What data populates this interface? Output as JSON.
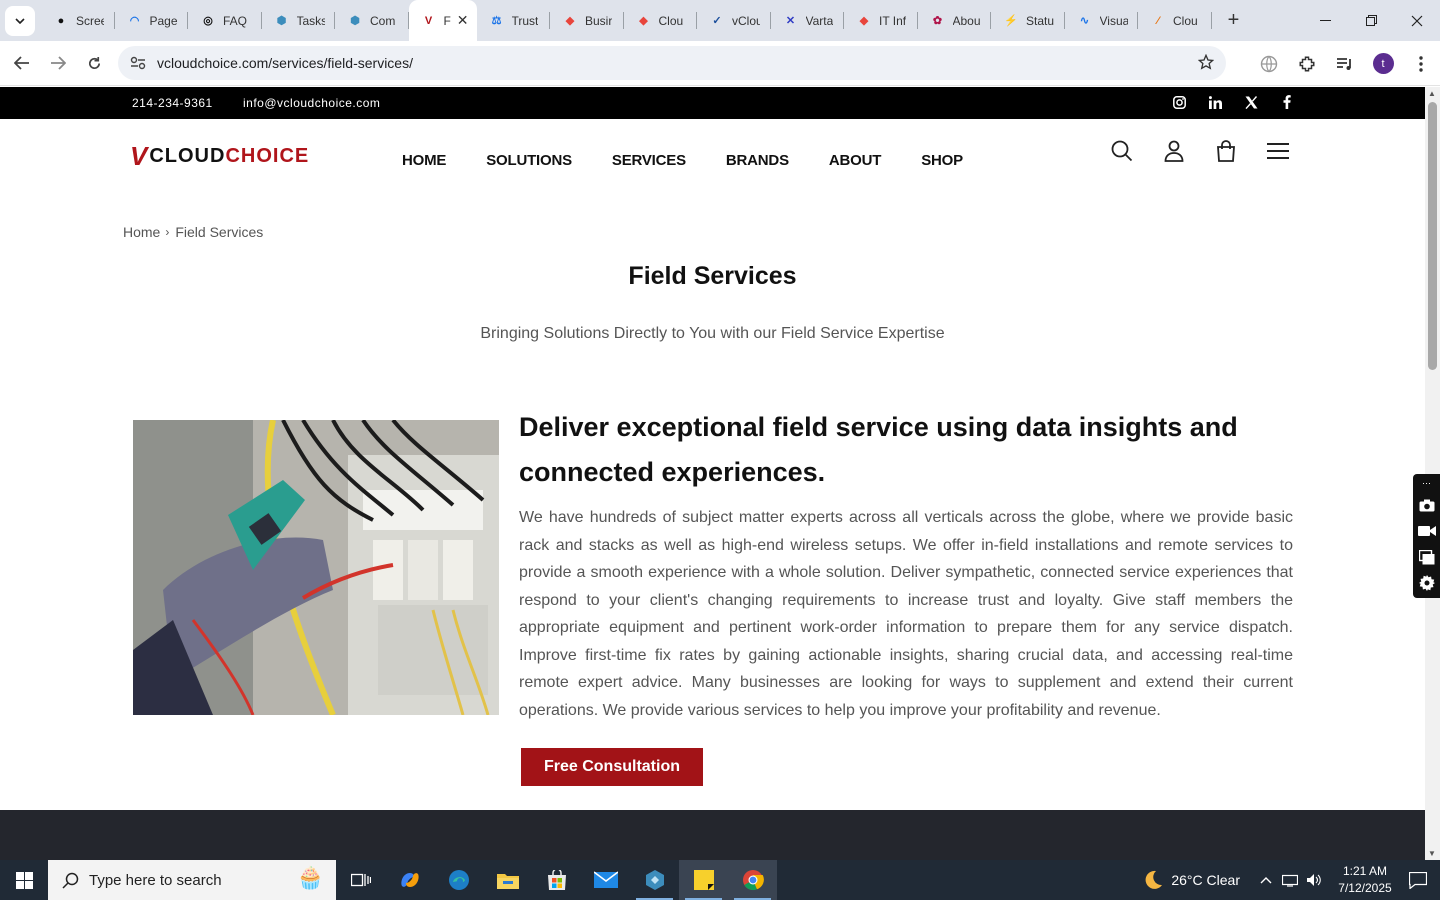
{
  "browser": {
    "tabs": [
      {
        "title": "Scree",
        "icon": "github-icon"
      },
      {
        "title": "Page",
        "icon": "gauge-icon"
      },
      {
        "title": "FAQ",
        "icon": "openai-icon"
      },
      {
        "title": "Tasks",
        "icon": "hexagon-icon"
      },
      {
        "title": "Com",
        "icon": "hexagon-icon"
      },
      {
        "title": "F",
        "icon": "vcloud-icon",
        "active": true
      },
      {
        "title": "Trust",
        "icon": "scales-icon"
      },
      {
        "title": "Busir",
        "icon": "tag-icon"
      },
      {
        "title": "Clou",
        "icon": "tag-icon"
      },
      {
        "title": "vClou",
        "icon": "check-icon"
      },
      {
        "title": "Varta",
        "icon": "x-brand-icon"
      },
      {
        "title": "IT Inf",
        "icon": "tag-icon"
      },
      {
        "title": "Abou",
        "icon": "flower-icon"
      },
      {
        "title": "Statu",
        "icon": "spark-icon"
      },
      {
        "title": "Visua",
        "icon": "pulse-icon"
      },
      {
        "title": "Clou",
        "icon": "slash-icon"
      }
    ],
    "url": "vcloudchoice.com/services/field-services/"
  },
  "site": {
    "phone": "214-234-9361",
    "email": "info@vcloudchoice.com",
    "logo": {
      "mark": "V",
      "part1": "CLOUD",
      "part2": "CHOICE"
    },
    "nav": [
      "HOME",
      "SOLUTIONS",
      "SERVICES",
      "BRANDS",
      "ABOUT",
      "SHOP"
    ],
    "breadcrumb": {
      "home": "Home",
      "current": "Field Services"
    },
    "page_title": "Field Services",
    "subtitle": "Bringing Solutions Directly to You with our Field Service Expertise",
    "heading": "Deliver exceptional field service using data insights and connected experiences.",
    "body": "We have hundreds of subject matter experts across all verticals across the globe, where we provide basic rack and stacks as well as high-end wireless setups. We offer in-field installations and remote services to provide a smooth experience with a whole solution. Deliver sympathetic, connected service experiences that respond to your client's changing requirements to increase trust and loyalty. Give staff members the appropriate equipment and pertinent work-order information to prepare them for any service dispatch. Improve first-time fix rates by gaining actionable insights, sharing crucial data, and accessing real-time remote expert advice. Many businesses are looking for ways to supplement and extend their current operations. We provide various services to help you improve your profitability and revenue.",
    "cta": "Free Consultation",
    "accent": "#a21317"
  },
  "taskbar": {
    "search_placeholder": "Type here to search",
    "weather": "26°C  Clear",
    "time": "1:21 AM",
    "date": "7/12/2025"
  }
}
